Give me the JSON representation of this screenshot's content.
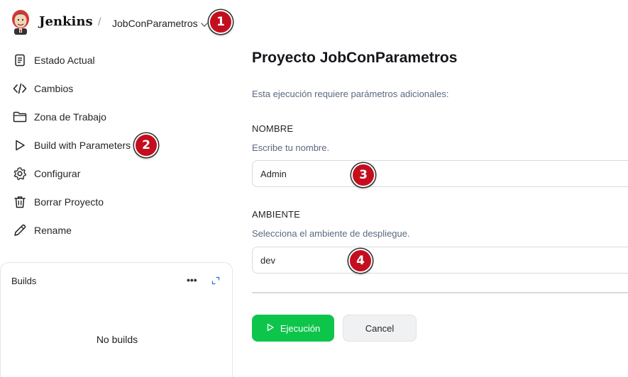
{
  "header": {
    "brand": "Jenkins",
    "separator": "/",
    "breadcrumb": "JobConParametros"
  },
  "sidebar": {
    "items": [
      {
        "label": "Estado Actual",
        "icon": "document-icon"
      },
      {
        "label": "Cambios",
        "icon": "code-icon"
      },
      {
        "label": "Zona de Trabajo",
        "icon": "folder-icon"
      },
      {
        "label": "Build with Parameters",
        "icon": "play-icon"
      },
      {
        "label": "Configurar",
        "icon": "gear-icon"
      },
      {
        "label": "Borrar Proyecto",
        "icon": "trash-icon"
      },
      {
        "label": "Rename",
        "icon": "pencil-icon"
      }
    ]
  },
  "builds": {
    "title": "Builds",
    "more": "•••",
    "empty_text": "No builds"
  },
  "main": {
    "title": "Proyecto JobConParametros",
    "description": "Esta ejecución requiere parámetros adicionales:",
    "params": [
      {
        "name": "NOMBRE",
        "description": "Escribe tu nombre.",
        "value": "Admin"
      },
      {
        "name": "AMBIENTE",
        "description": "Selecciona el ambiente de despliegue.",
        "value": "dev"
      }
    ],
    "run_label": "Ejecución",
    "cancel_label": "Cancel"
  },
  "annotations": [
    "1",
    "2",
    "3",
    "4"
  ],
  "colors": {
    "accent_green": "#0ec54b",
    "badge_red": "#c40e1e",
    "muted_text": "#5a6a80"
  }
}
